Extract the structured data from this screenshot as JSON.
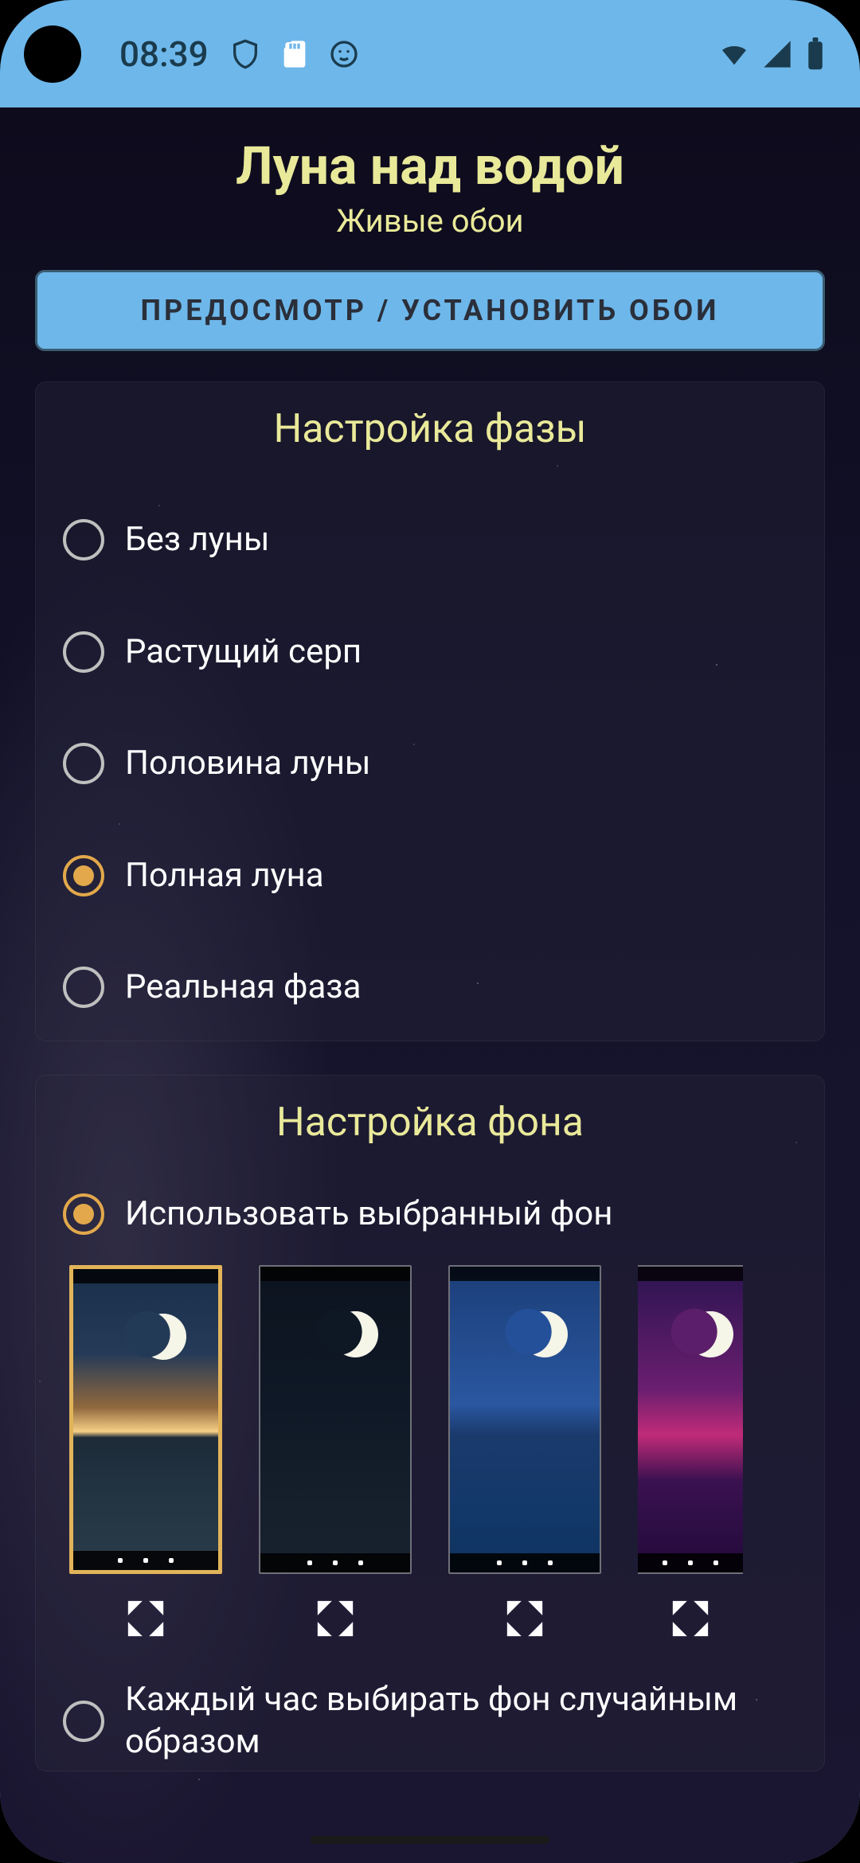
{
  "status": {
    "clock": "08:39",
    "icons_left": [
      "shield-outline",
      "sd-card",
      "face-neutral"
    ],
    "icons_right": [
      "wifi",
      "signal",
      "battery"
    ]
  },
  "header": {
    "title": "Луна над водой",
    "subtitle": "Живые обои"
  },
  "primary_button_label": "ПРЕДОСМОТР / УСТАНОВИТЬ ОБОИ",
  "phase_card": {
    "title": "Настройка фазы",
    "options": [
      {
        "label": "Без луны",
        "selected": false
      },
      {
        "label": "Растущий серп",
        "selected": false
      },
      {
        "label": "Половина луны",
        "selected": false
      },
      {
        "label": "Полная луна",
        "selected": true
      },
      {
        "label": "Реальная фаза",
        "selected": false
      }
    ]
  },
  "bg_card": {
    "title": "Настройка фона",
    "use_selected_bg_label": "Использовать выбранный фон",
    "use_selected_bg_selected": true,
    "thumbs": [
      {
        "name": "sunset",
        "selected": true
      },
      {
        "name": "night",
        "selected": false
      },
      {
        "name": "blue",
        "selected": false
      },
      {
        "name": "magenta",
        "selected": false
      }
    ],
    "random_hourly_label": "Каждый час выбирать фон случайным образом",
    "random_hourly_selected": false
  },
  "colors": {
    "accent": "#E2A84B",
    "title_color": "#E9E99A",
    "status_bar_bg": "#6EB7EA",
    "button_bg": "#6EB7EA"
  }
}
